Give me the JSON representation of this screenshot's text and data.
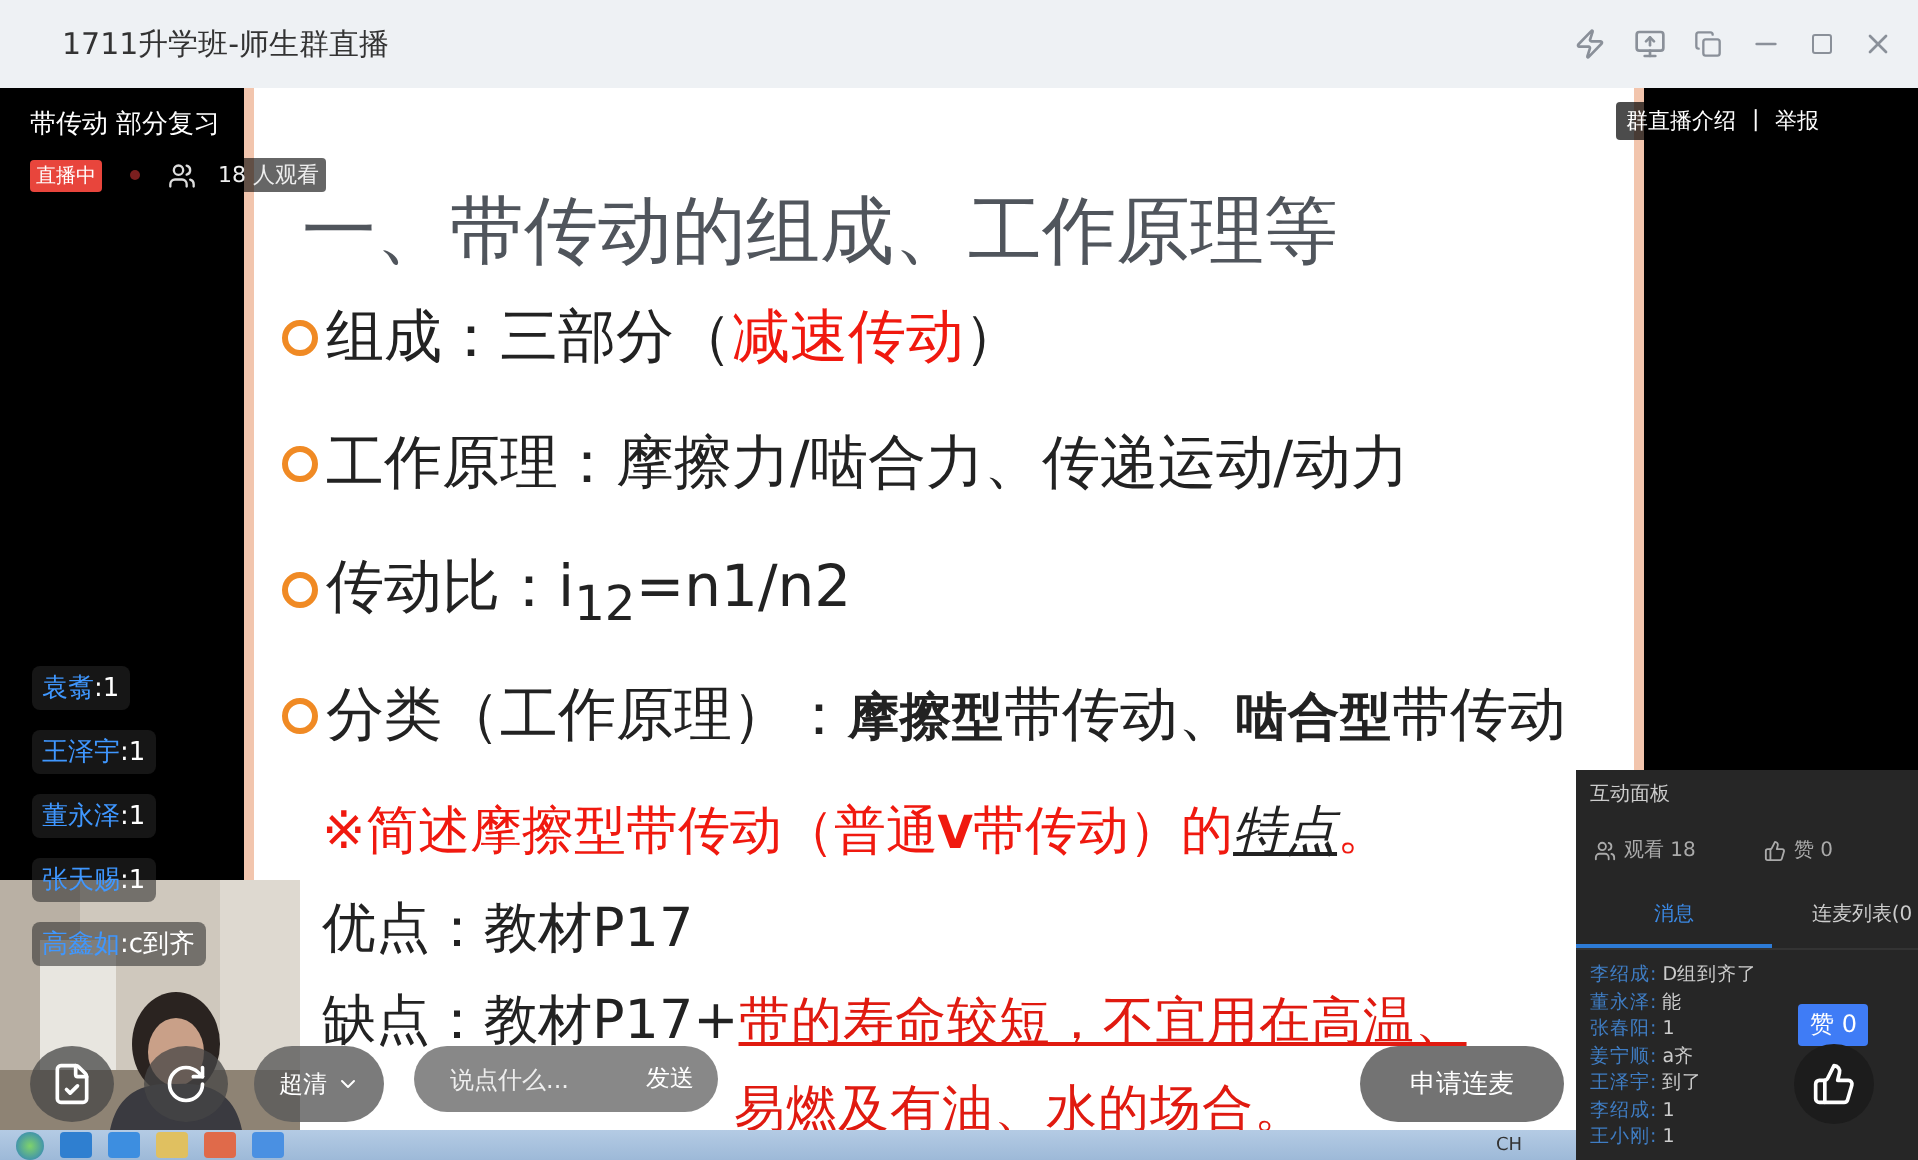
{
  "window": {
    "title": "1711升学班-师生群直播"
  },
  "stream": {
    "title": "带传动 部分复习",
    "live_badge": "直播中",
    "viewers": "18 人观看",
    "links": [
      "群直播介绍",
      "举报"
    ],
    "link_separator": "|"
  },
  "slide": {
    "title": "一、带传动的组成、工作原理等",
    "lines": [
      {
        "kind": "bullet",
        "segments": [
          {
            "kind": "plain",
            "text": "组成：三部分（"
          },
          {
            "kind": "emphasis",
            "text": "减速传动"
          },
          {
            "kind": "plain",
            "text": "）"
          }
        ]
      },
      {
        "kind": "bullet",
        "segments": [
          {
            "kind": "plain",
            "text": "工作原理：摩擦力/啮合力、传递运动/动力"
          }
        ]
      },
      {
        "kind": "bullet",
        "segments": [
          {
            "kind": "plain",
            "text": "传动比：i$_{12}$=n1/n2"
          }
        ]
      },
      {
        "kind": "bullet",
        "segments": [
          {
            "kind": "plain",
            "text": "分类（工作原理）：**摩擦型**带传动、**啮合型**带传动"
          }
        ]
      },
      {
        "kind": "heading",
        "segments": [
          {
            "kind": "emphasis",
            "text": "※简述摩擦型带传动（普通**V**带传动）的"
          },
          {
            "kind": "keyword",
            "text": "特点"
          },
          {
            "kind": "emphasis",
            "text": "。"
          }
        ]
      },
      {
        "kind": "plain",
        "segments": [
          {
            "kind": "plain",
            "text": "优点：教材P17"
          }
        ]
      },
      {
        "kind": "plain",
        "segments": [
          {
            "kind": "plain",
            "text": "缺点：教材P17+"
          },
          {
            "kind": "note",
            "text": "带的寿命较短，不宜用在高温、"
          }
        ]
      },
      {
        "kind": "continuation",
        "segments": [
          {
            "kind": "note",
            "text": "易燃及有油、水的场合。"
          }
        ]
      }
    ]
  },
  "chat": [
    {
      "name": "袁翥",
      "message": ":1"
    },
    {
      "name": "王泽宇",
      "message": ":1"
    },
    {
      "name": "董永泽",
      "message": ":1"
    },
    {
      "name": "张天赐",
      "message": ":1"
    },
    {
      "name": "高鑫如",
      "message": ":c到齐"
    }
  ],
  "controls": {
    "quality": "超清",
    "input": {
      "placeholder": "说点什么..."
    },
    "send": "发送",
    "mic_request": "申请连麦",
    "like_badge": "赞 0"
  },
  "panel": {
    "title": "互动面板",
    "viewers": "观看 18",
    "likes": "赞 0",
    "tabs": [
      {
        "label": "消息",
        "selected": true
      },
      {
        "label": "连麦列表(0",
        "selected": false
      }
    ],
    "messages": [
      {
        "name": "李绍成:",
        "text": "D组到齐了"
      },
      {
        "name": "董永泽:",
        "text": "能"
      },
      {
        "name": "张春阳:",
        "text": "1"
      },
      {
        "name": "姜宁顺:",
        "text": "a齐"
      },
      {
        "name": "王泽宇:",
        "text": "到了"
      },
      {
        "name": "李绍成:",
        "text": "1"
      },
      {
        "name": "王小刚:",
        "text": "1"
      }
    ]
  },
  "taskbar": {
    "language": "CH"
  }
}
